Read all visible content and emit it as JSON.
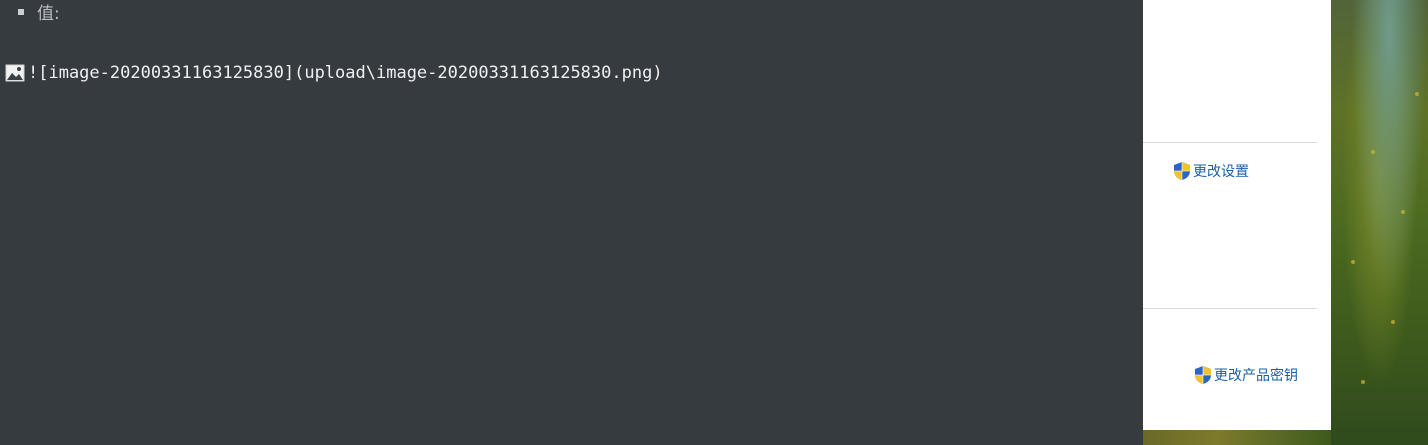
{
  "editor": {
    "bullet_text": "值:",
    "image_markdown": "![image-20200331163125830](upload\\image-20200331163125830.png)"
  },
  "panel": {
    "change_settings_label": "更改设置",
    "change_product_key_label": "更改产品密钥"
  },
  "colors": {
    "editor_bg": "#363b40",
    "panel_bg": "#ffffff",
    "link": "#1a5fa8"
  },
  "icons": {
    "broken_image": "broken-image-icon",
    "uac_shield": "uac-shield-icon"
  }
}
